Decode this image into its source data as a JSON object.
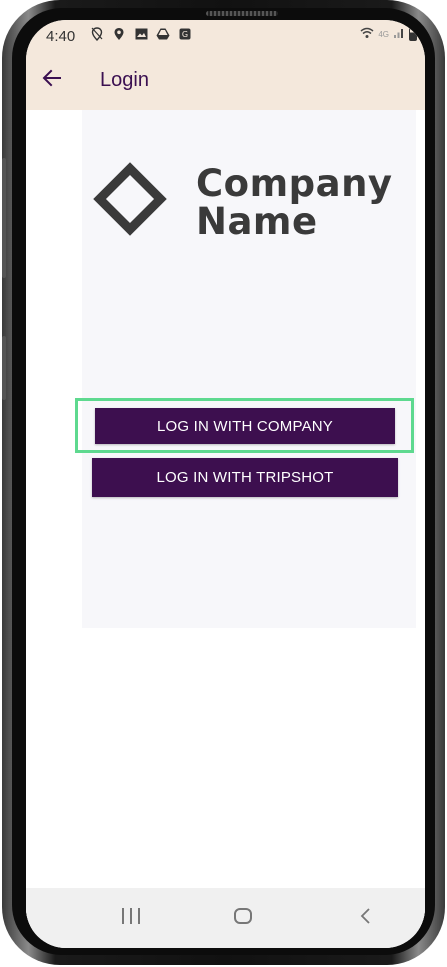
{
  "status_bar": {
    "time": "4:40",
    "network": "4G",
    "left_icons": [
      "location-off-icon",
      "location-icon",
      "image-icon",
      "drive-icon",
      "app-icon"
    ],
    "right_icons": [
      "wifi-icon",
      "signal-icon",
      "battery-icon"
    ]
  },
  "app_bar": {
    "title": "Login",
    "back_icon": "back-arrow-icon"
  },
  "logo": {
    "line1": "Company",
    "line2": "Name"
  },
  "buttons": {
    "company": "LOG IN WITH COMPANY",
    "tripshot": "LOG IN WITH TRIPSHOT"
  },
  "colors": {
    "app_bar_bg": "#f4e8dc",
    "title_color": "#3b1051",
    "button_bg": "#3d0f4f",
    "highlight": "#5ed98f",
    "logo_color": "#3a3a3a"
  },
  "nav_bar": {
    "recent_icon": "recent-apps-icon",
    "home_icon": "home-icon",
    "back_icon": "nav-back-icon"
  }
}
